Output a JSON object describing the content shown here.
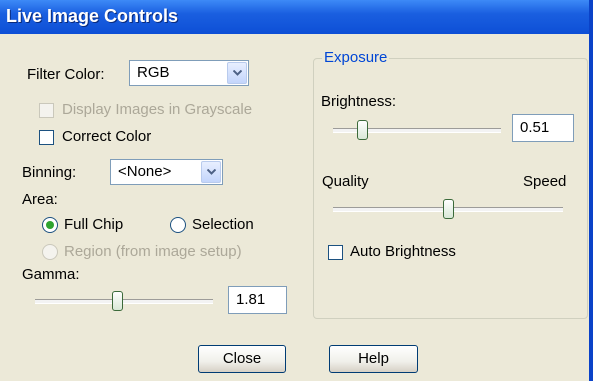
{
  "window": {
    "title": "Live Image Controls"
  },
  "left": {
    "filter_color": {
      "label": "Filter Color:",
      "value": "RGB"
    },
    "grayscale": {
      "label": "Display Images in Grayscale",
      "checked": false,
      "enabled": false
    },
    "correct_color": {
      "label": "Correct Color",
      "checked": false
    },
    "binning": {
      "label": "Binning:",
      "value": "<None>"
    },
    "area": {
      "label": "Area:",
      "full_chip": "Full Chip",
      "selection": "Selection",
      "region": "Region (from image setup)",
      "selected": "Full Chip"
    },
    "gamma": {
      "label": "Gamma:",
      "value": "1.81",
      "slider_fraction": 0.46
    }
  },
  "exposure": {
    "title": "Exposure",
    "brightness": {
      "label": "Brightness:",
      "value": "0.51",
      "slider_fraction": 0.17
    },
    "quality_label": "Quality",
    "speed_label": "Speed",
    "quality_speed_fraction": 0.5,
    "auto_brightness": {
      "label": "Auto Brightness",
      "checked": false
    }
  },
  "buttons": {
    "close": "Close",
    "help": "Help"
  },
  "colors": {
    "titlebar": "#0d4fd6",
    "group_title": "#0046d5",
    "face": "#ece9d8",
    "radio_dot": "#2fa32f"
  },
  "icons": [
    "chevron-down-icon"
  ]
}
